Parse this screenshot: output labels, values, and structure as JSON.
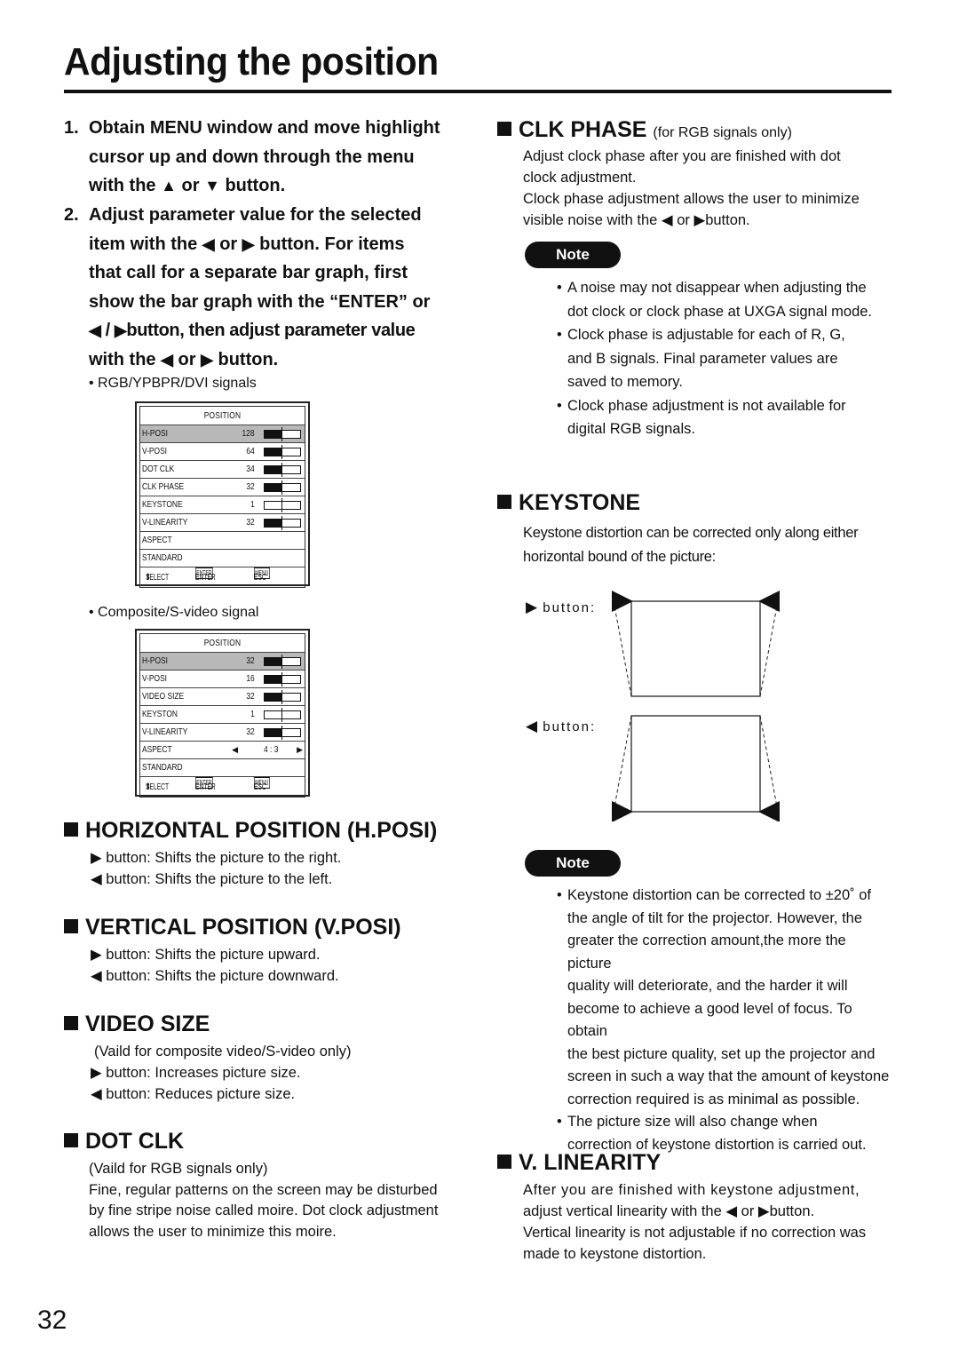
{
  "page": {
    "title": "Adjusting the position",
    "page_number": "32"
  },
  "steps": [
    {
      "num": "1.",
      "lines": [
        "Obtain MENU window and move highlight",
        "cursor up and down through the menu"
      ],
      "tail": {
        "pre": "with the",
        "icon1": "▲",
        "mid": "or",
        "icon2": "▼",
        "post": "button."
      }
    },
    {
      "num": "2.",
      "line1": "Adjust parameter value for the selected",
      "line2": {
        "pre": "item with the",
        "icon1": "◀",
        "mid": "or",
        "icon2": "▶",
        "post": "button. For items"
      },
      "line3": "that call for a separate bar graph, first",
      "line4": "show the bar graph with the “ENTER” or",
      "line5": {
        "icon1": "◀",
        "mid": "/",
        "icon2": "▶",
        "post": "button, then adjust parameter value"
      },
      "line6": {
        "pre": "with the",
        "icon1": "◀",
        "mid": "or",
        "icon2": "▶",
        "post": "button."
      }
    }
  ],
  "menus": [
    {
      "caption": "• RGB/YPBPR/DVI signals",
      "title": "POSITION",
      "rows": [
        {
          "label": "H-POSI",
          "value": "128",
          "bar": 0.5,
          "selected": true
        },
        {
          "label": "V-POSI",
          "value": "64",
          "bar": 0.5
        },
        {
          "label": "DOT CLK",
          "value": "34",
          "bar": 0.5
        },
        {
          "label": "CLK PHASE",
          "value": "32",
          "bar": 0.5
        },
        {
          "label": "KEYSTONE",
          "value": "1",
          "bar": 0.0
        },
        {
          "label": "V-LINEARITY",
          "value": "32",
          "bar": 0.5
        },
        {
          "label": "ASPECT"
        },
        {
          "label": "STANDARD"
        }
      ],
      "footer": {
        "select": "SELECT",
        "enter_key": "ENTER",
        "enter": "ENTER",
        "menu_key": "MENU",
        "esc": "ESC"
      }
    },
    {
      "caption": "• Composite/S-video signal",
      "title": "POSITION",
      "rows": [
        {
          "label": "H-POSI",
          "value": "32",
          "bar": 0.5,
          "selected": true
        },
        {
          "label": "V-POSI",
          "value": "16",
          "bar": 0.5
        },
        {
          "label": "VIDEO SIZE",
          "value": "32",
          "bar": 0.5
        },
        {
          "label": "KEYSTON",
          "value": "1",
          "bar": 0.0
        },
        {
          "label": "V-LINEARITY",
          "value": "32",
          "bar": 0.5
        },
        {
          "label": "ASPECT",
          "option": "4 : 3"
        },
        {
          "label": "STANDARD"
        }
      ],
      "footer": {
        "select": "SELECT",
        "enter_key": "ENTER",
        "enter": "ENTER",
        "menu_key": "MENU",
        "esc": "ESC"
      }
    }
  ],
  "sections": {
    "hposi": {
      "heading": "HORIZONTAL POSITION (H.POSI)",
      "lines": [
        {
          "icon": "▶",
          "text": "button:  Shifts the picture to the right."
        },
        {
          "icon": "◀",
          "text": "button:  Shifts the picture to the left."
        }
      ]
    },
    "vposi": {
      "heading": "VERTICAL POSITION (V.POSI)",
      "lines": [
        {
          "icon": "▶",
          "text": "button:  Shifts the picture upward."
        },
        {
          "icon": "◀",
          "text": "button:  Shifts the picture downward."
        }
      ]
    },
    "videosize": {
      "heading": "VIDEO SIZE",
      "subnote": "(Vaild for composite video/S-video only)",
      "lines": [
        {
          "icon": "▶",
          "text": "button:  Increases picture size."
        },
        {
          "icon": "◀",
          "text": "button:  Reduces picture size."
        }
      ]
    },
    "dotclk": {
      "heading": "DOT CLK",
      "subnote": "(Vaild for RGB signals only)",
      "body": [
        "Fine, regular patterns on the screen may be disturbed",
        "by fine stripe noise called moire. Dot clock adjustment",
        "allows the user to minimize this moire."
      ]
    },
    "clkphase": {
      "heading": "CLK PHASE",
      "heading_sub": "(for RGB signals only)",
      "body": [
        "Adjust clock phase after you are finished with dot",
        "clock adjustment.",
        "Clock phase adjustment allows the user to minimize"
      ],
      "last": {
        "pre": "visible noise with the",
        "icon1": "◀",
        "mid": "or",
        "icon2": "▶",
        "post": "button."
      },
      "note_label": "Note",
      "notes": [
        [
          "A noise may not disappear when adjusting the",
          "dot clock or clock phase at UXGA signal mode."
        ],
        [
          "Clock phase is adjustable for each of R, G,",
          "and B signals. Final parameter values are",
          "saved to memory."
        ],
        [
          "Clock phase adjustment is not available for",
          "digital RGB signals."
        ]
      ]
    },
    "keystone": {
      "heading": "KEYSTONE",
      "body": [
        "Keystone distortion can be corrected only along either",
        "horizontal bound of the picture:"
      ],
      "diagram": [
        {
          "icon": "▶",
          "label": "button:"
        },
        {
          "icon": "◀",
          "label": "button:"
        }
      ],
      "note_label": "Note",
      "notes": [
        [
          "Keystone distortion can be corrected to ±20˚ of",
          "the angle of tilt for the projector. However, the",
          "greater the correction amount,the more the picture",
          "quality will deteriorate, and the harder it will",
          "become to achieve a good level of focus. To obtain",
          "the best picture quality, set up the projector and",
          "screen in such a way that the amount of keystone",
          "correction required is as minimal as possible."
        ],
        [
          "The picture size will also change when",
          "correction of keystone distortion is carried out."
        ]
      ]
    },
    "vlinearity": {
      "heading": "V. LINEARITY",
      "line1": "After you are finished with keystone adjustment,",
      "line2": {
        "pre": "adjust vertical linearity with the",
        "icon1": "◀",
        "mid": "or",
        "icon2": "▶",
        "post": "button."
      },
      "line3": "Vertical linearity is not adjustable if no correction was",
      "line4": "made to keystone distortion."
    }
  }
}
